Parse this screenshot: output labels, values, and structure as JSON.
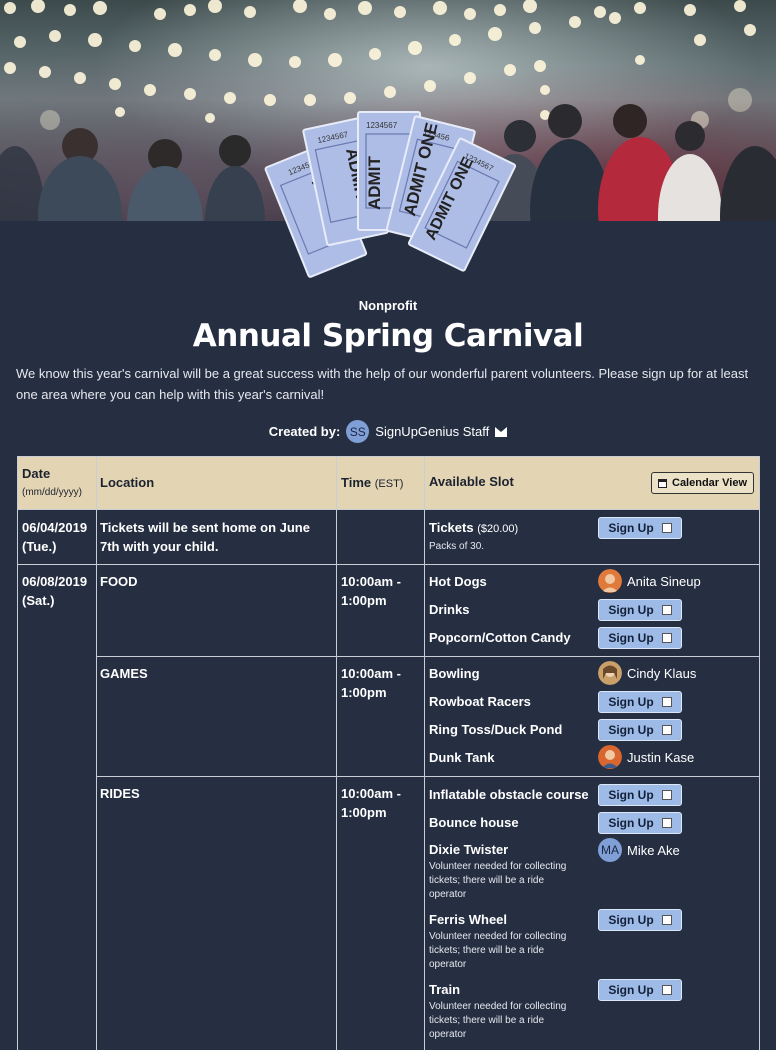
{
  "banner": {
    "ticket_text": [
      "ADMIT",
      "ADMIT",
      "ADMIT",
      "ADMIT ONE"
    ],
    "ticket_numbers": [
      "1234567",
      "1234567",
      "1234567",
      "123456",
      "1234567"
    ]
  },
  "header": {
    "category": "Nonprofit",
    "title": "Annual Spring Carnival",
    "description": "We know this year's carnival will be a great success with the help of our wonderful parent volunteers.  Please sign up for at least one area where you can help with this year's carnival!",
    "created_by_label": "Created by:",
    "creator_initials": "SS",
    "creator_name": "SignUpGenius Staff"
  },
  "table": {
    "headers": {
      "date": "Date",
      "date_format": "(mm/dd/yyyy)",
      "location": "Location",
      "time": "Time",
      "time_zone": "(EST)",
      "slot": "Available Slot",
      "calendar_view": "Calendar View"
    },
    "signup_label": "Sign Up",
    "rows": {
      "r1": {
        "date": "06/04/2019",
        "day": "(Tue.)",
        "location": "Tickets will be sent home on June 7th with your child.",
        "slot": "Tickets",
        "price": "($20.00)",
        "note": "Packs of 30."
      },
      "r2": {
        "date": "06/08/2019",
        "day": "(Sat.)"
      },
      "food": {
        "location": "FOOD",
        "time1": "10:00am -",
        "time2": "1:00pm",
        "slots": [
          "Hot Dogs",
          "Drinks",
          "Popcorn/Cotton Candy"
        ],
        "volunteer": "Anita Sineup"
      },
      "games": {
        "location": "GAMES",
        "time1": "10:00am -",
        "time2": "1:00pm",
        "slots": [
          "Bowling",
          "Rowboat Racers",
          "Ring Toss/Duck Pond",
          "Dunk Tank"
        ],
        "volunteers": [
          "Cindy Klaus",
          "Justin Kase"
        ]
      },
      "rides": {
        "location": "RIDES",
        "time1": "10:00am -",
        "time2": "1:00pm",
        "slots": [
          "Inflatable obstacle course",
          "Bounce house",
          "Dixie Twister",
          "Ferris Wheel",
          "Train"
        ],
        "note_line1": "Volunteer needed for collecting",
        "note_line2": "tickets; there will be a ride",
        "note_line3": "operator",
        "volunteer_initials": "MA",
        "volunteer": "Mike Ake"
      }
    }
  }
}
